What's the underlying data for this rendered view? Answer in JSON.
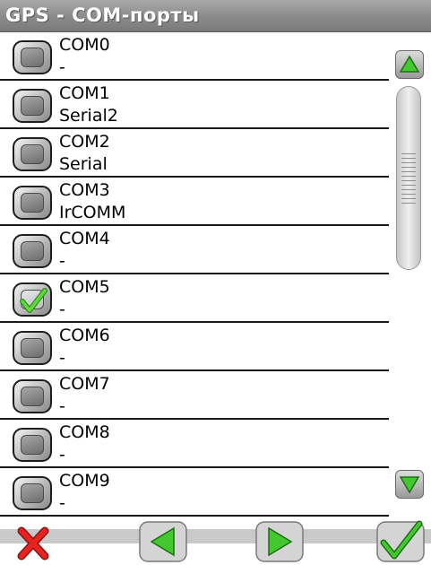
{
  "title": "GPS - COM-порты",
  "ports": [
    {
      "name": "COM0",
      "sub": "-",
      "checked": false
    },
    {
      "name": "COM1",
      "sub": "Serial2",
      "checked": false
    },
    {
      "name": "COM2",
      "sub": "Serial",
      "checked": false
    },
    {
      "name": "COM3",
      "sub": "IrCOMM",
      "checked": false
    },
    {
      "name": "COM4",
      "sub": "-",
      "checked": false
    },
    {
      "name": "COM5",
      "sub": "-",
      "checked": true
    },
    {
      "name": "COM6",
      "sub": "-",
      "checked": false
    },
    {
      "name": "COM7",
      "sub": "-",
      "checked": false
    },
    {
      "name": "COM8",
      "sub": "-",
      "checked": false
    },
    {
      "name": "COM9",
      "sub": "-",
      "checked": false
    }
  ],
  "icons": {
    "scroll_up": "triangle-up-icon",
    "scroll_down": "triangle-down-icon",
    "cancel": "red-x-icon",
    "back": "left-arrow-icon",
    "forward": "right-arrow-icon",
    "confirm": "check-icon"
  },
  "colors": {
    "title_bg": "#8a8a8a",
    "accent_green": "#43c82f",
    "cancel_red": "#e8231f"
  }
}
